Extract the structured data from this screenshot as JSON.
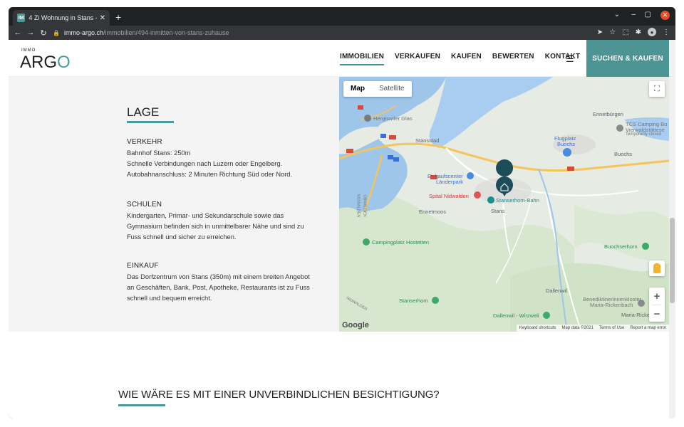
{
  "browser": {
    "tab_title": "4 Zi Wohnung in Stans - I",
    "favicon": "IM",
    "url_host": "immo-argo.ch",
    "url_path": "/immobilien/494-inmitten-von-stans-zuhause"
  },
  "header": {
    "logo_small": "IMMO",
    "logo_a": "ARG",
    "logo_o": "O",
    "nav": [
      "IMMOBILIEN",
      "VERKAUFEN",
      "KAUFEN",
      "BEWERTEN",
      "KONTAKT"
    ],
    "cta": "SUCHEN & KAUFEN",
    "accent": "#4a9a9a"
  },
  "info": {
    "title": "LAGE",
    "sections": [
      {
        "title": "VERKEHR",
        "lines": [
          "Bahnhof Stans: 250m",
          "Schnelle Verbindungen nach Luzern oder Engelberg.",
          "Autobahnanschluss: 2 Minuten Richtung Süd oder Nord."
        ]
      },
      {
        "title": "SCHULEN",
        "lines": [
          "Kindergarten, Primar- und Sekundarschule sowie das",
          "Gymnasium befinden sich in unmittelbarer Nähe und sind zu",
          "Fuss schnell und sicher zu erreichen."
        ]
      },
      {
        "title": "EINKAUF",
        "lines": [
          "Das Dorfzentrum von Stans (350m) mit einem breiten Angebot",
          "an Geschäften, Bank, Post, Apotheke, Restaurants ist zu Fuss",
          "schnell und bequem erreicht."
        ]
      }
    ]
  },
  "map": {
    "type_map": "Map",
    "type_satellite": "Satellite",
    "google": "Google",
    "footer": [
      "Keyboard shortcuts",
      "Map data ©2021",
      "Terms of Use",
      "Report a map error"
    ],
    "labels": {
      "hergiswil": "Hergiswiler Glas",
      "stansstad": "Stansstad",
      "ennetburgen": "Ennetbürgen",
      "tcs1": "TCS Camping Bu",
      "tcs2": "Vierwaldstättese",
      "tcs3": "Temporarily closed",
      "flugplatz1": "Flugplatz",
      "flugplatz2": "Buochs",
      "buochs": "Buochs",
      "einkauf1": "Einkaufscenter",
      "einkauf2": "Länderpark",
      "spital": "Spital Nidwalden",
      "stanserhornbahn": "Stanserhorn-Bahn",
      "stans": "Stans",
      "ennetmoos": "Ennetmoos",
      "camping": "Campingplatz Hostetten",
      "buochserhorn": "Buochserhorn",
      "dallenwil": "Dallenwil",
      "kloster1": "Benediktinerinnenkloster",
      "kloster2": "Maria-Rickenbach",
      "mariaricke": "Maria-Ricke",
      "stanserhorn": "Stanserhorn",
      "wirzweli": "Dallenwil - Wirzweli",
      "nidwalden1": "NIDWALDEN",
      "nidwalden2": "OBWALDEN",
      "nidwalden3": "NIDWALDEN"
    }
  },
  "bottom": {
    "title": "WIE WÄRE ES MIT EINER UNVERBINDLICHEN BESICHTIGUNG?"
  }
}
